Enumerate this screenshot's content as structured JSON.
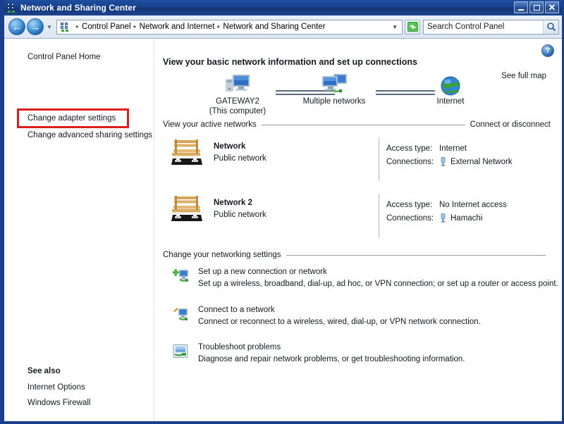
{
  "window": {
    "title": "Network and Sharing Center",
    "icon": "network-sharing-icon",
    "buttons": {
      "minimize": "minimize-button",
      "maximize": "maximize-button",
      "close": "✕"
    }
  },
  "navbar": {
    "back": "←",
    "forward": "→",
    "history_chevron": "▼",
    "breadcrumb": {
      "icon": "network-breadcrumb-icon",
      "separator": "▸",
      "items": [
        "Control Panel",
        "Network and Internet",
        "Network and Sharing Center"
      ]
    },
    "address_chevron": "▼",
    "refresh": "refresh-icon",
    "search": {
      "placeholder": "Search Control Panel",
      "value": "Search Control Panel",
      "icon": "search-icon"
    }
  },
  "sidebar": {
    "links": [
      {
        "label": "Control Panel Home",
        "highlighted": false
      },
      {
        "label": "Change adapter settings",
        "highlighted": true
      },
      {
        "label": "Change advanced sharing settings",
        "highlighted": false
      }
    ],
    "see_also": {
      "heading": "See also",
      "links": [
        "Internet Options",
        "Windows Firewall"
      ]
    }
  },
  "main": {
    "heading": "View your basic network information and set up connections",
    "see_full_map": "See full map",
    "help": "?",
    "network_map": {
      "nodes": [
        {
          "name": "GATEWAY2",
          "subname": "(This computer)",
          "icon": "computer-icon"
        },
        {
          "name": "Multiple networks",
          "subname": "",
          "icon": "multiple-networks-icon"
        },
        {
          "name": "Internet",
          "subname": "",
          "icon": "globe-icon"
        }
      ]
    },
    "active_networks": {
      "heading": "View your active networks",
      "action": "Connect or disconnect",
      "rows": [
        {
          "icon": "public-network-bench-icon",
          "name": "Network",
          "type": "Public network",
          "access_label": "Access type:",
          "access_value": "Internet",
          "connections_label": "Connections:",
          "connections_icon": "network-adapter-icon",
          "connections_value": "External Network"
        },
        {
          "icon": "public-network-bench-icon",
          "name": "Network  2",
          "type": "Public network",
          "access_label": "Access type:",
          "access_value": "No Internet access",
          "connections_label": "Connections:",
          "connections_icon": "network-adapter-icon",
          "connections_value": "Hamachi"
        }
      ]
    },
    "settings": {
      "heading": "Change your networking settings",
      "tasks": [
        {
          "icon": "new-connection-icon",
          "title": "Set up a new connection or network",
          "desc": "Set up a wireless, broadband, dial-up, ad hoc, or VPN connection; or set up a router or access point."
        },
        {
          "icon": "connect-network-icon",
          "title": "Connect to a network",
          "desc": "Connect or reconnect to a wireless, wired, dial-up, or VPN network connection."
        },
        {
          "icon": "troubleshoot-icon",
          "title": "Troubleshoot problems",
          "desc": "Diagnose and repair network problems, or get troubleshooting information."
        }
      ]
    }
  },
  "annotation": {
    "color": "#e01c1c",
    "target": "Change adapter settings"
  }
}
